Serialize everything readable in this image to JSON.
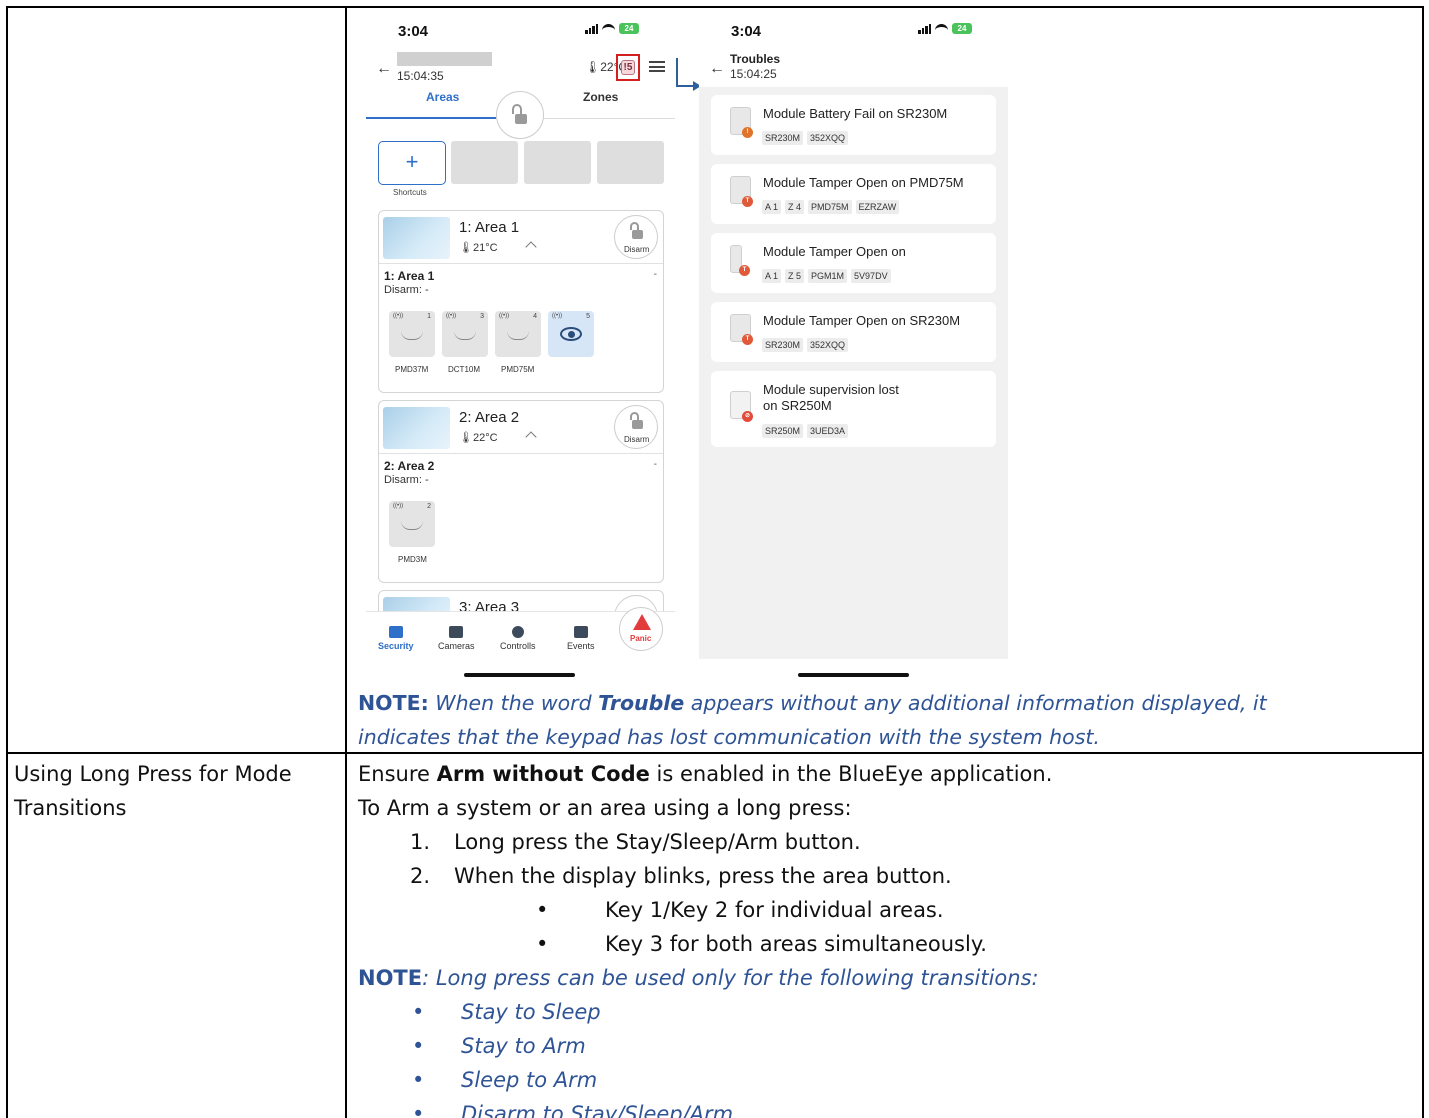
{
  "phone_left": {
    "status_time": "3:04",
    "battery": "24",
    "header_time": "15:04:35",
    "temperature": "22°C",
    "trouble_badge": "!5",
    "tabs": [
      "Areas",
      "Zones"
    ],
    "shortcuts_label": "Shortcuts",
    "shortcut_plus": "+",
    "areas": [
      {
        "title": "1: Area 1",
        "temp": "21°C",
        "disarm_button": "Disarm",
        "sub_title": "1: Area 1",
        "status": "Disarm: -",
        "dash": "-",
        "zones": [
          {
            "num": "1",
            "label": "PMD37M"
          },
          {
            "num": "3",
            "label": "DCT10M"
          },
          {
            "num": "4",
            "label": "PMD75M"
          },
          {
            "num": "5",
            "label": ""
          }
        ]
      },
      {
        "title": "2: Area 2",
        "temp": "22°C",
        "disarm_button": "Disarm",
        "sub_title": "2: Area 2",
        "status": "Disarm: -",
        "dash": "-",
        "zones": [
          {
            "num": "2",
            "label": "PMD3M"
          }
        ]
      },
      {
        "title": "3: Area 3"
      }
    ],
    "nav": [
      "Security",
      "Cameras",
      "Controlls",
      "Events"
    ],
    "panic": "Panic"
  },
  "phone_right": {
    "status_time": "3:04",
    "battery": "24",
    "title": "Troubles",
    "header_time": "15:04:25",
    "troubles": [
      {
        "text": "Module Battery Fail on SR230M",
        "tags": [
          "SR230M",
          "352XQQ"
        ]
      },
      {
        "text": "Module Tamper Open on PMD75M",
        "tags": [
          "A 1",
          "Z 4",
          "PMD75M",
          "EZRZAW"
        ]
      },
      {
        "text": "Module Tamper Open on",
        "tags": [
          "A 1",
          "Z 5",
          "PGM1M",
          "5V97DV"
        ]
      },
      {
        "text": "Module Tamper Open on SR230M",
        "tags": [
          "SR230M",
          "352XQQ"
        ]
      },
      {
        "text": "Module supervision lost on SR250M",
        "tags": [
          "SR250M",
          "3UED3A"
        ]
      }
    ]
  },
  "note1": {
    "label": "NOTE:",
    "part1": " When the word ",
    "keyword": "Trouble",
    "part2": " appears without any additional information displayed, it",
    "line2": "indicates that the keypad has lost communication with the system host."
  },
  "row2": {
    "heading_line1": "Using Long Press for Mode",
    "heading_line2": "Transitions",
    "ensure_pre": "Ensure ",
    "ensure_bold": "Arm without Code",
    "ensure_post": " is enabled in the BlueEye application.",
    "intro": "To Arm a system or an area using a long press:",
    "steps": [
      "Long press the Stay/Sleep/Arm button.",
      "When the display blinks, press the area button."
    ],
    "step_nums": [
      "1.",
      "2."
    ],
    "sub_bullets": [
      "Key 1/Key 2 for individual areas.",
      "Key 3 for both areas simultaneously."
    ],
    "note_label": "NOTE",
    "note_text": ": Long press can be used only for the following transitions:",
    "transitions": [
      "Stay to Sleep",
      "Stay to Arm",
      "Sleep to Arm",
      "Disarm to Stay/Sleep/Arm"
    ]
  }
}
